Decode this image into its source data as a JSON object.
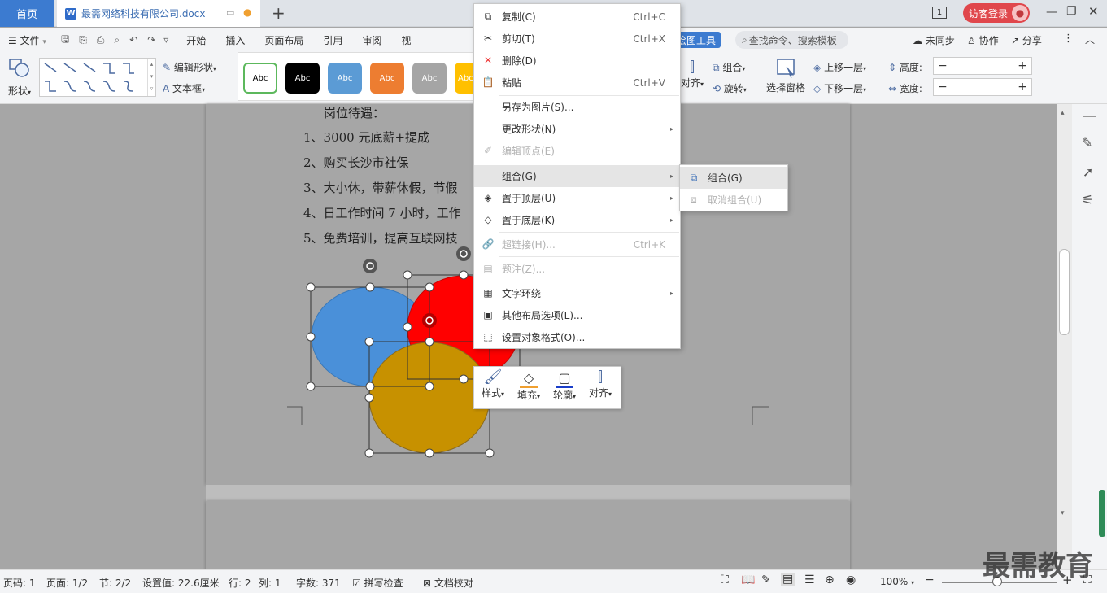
{
  "tabs": {
    "home": "首页",
    "doc_title": "最需网络科技有限公司.docx",
    "doc_badge": "W"
  },
  "window": {
    "user_button": "访客登录",
    "page_badge": "1"
  },
  "menu": {
    "file": "文件",
    "items": [
      "开始",
      "插入",
      "页面布局",
      "引用",
      "审阅",
      "视"
    ],
    "drawing_tools": "绘图工具",
    "search_placeholder": "查找命令、搜索模板",
    "sync": "未同步",
    "collab": "协作",
    "share": "分享"
  },
  "ribbon": {
    "shapes": "形状",
    "edit_shape": "编辑形状",
    "textbox": "文本框",
    "abc": "Abc",
    "group": "组合",
    "rotate": "旋转",
    "align": "对齐",
    "selection_pane": "选择窗格",
    "bring_forward": "上移一层",
    "send_backward": "下移一层",
    "height": "高度:",
    "width": "宽度:"
  },
  "colors": {
    "blue_circle": "#4a90d9",
    "red_circle": "#ff0000",
    "gold_circle": "#c79100",
    "style_white": "#ffffff",
    "style_black": "#000000",
    "style_blue": "#5b9bd5",
    "style_orange": "#ed7d31",
    "style_gray": "#a5a5a5",
    "style_yellow": "#ffc000"
  },
  "document": {
    "lines": [
      "岗位待遇：",
      "1、3000 元底薪+提成",
      "2、购买长沙市社保",
      "3、大小休，带薪休假，节假",
      "4、日工作时间 7 小时，工作",
      "5、免费培训，提高互联网技"
    ]
  },
  "context_menu": {
    "copy": {
      "label": "复制(C)",
      "shortcut": "Ctrl+C"
    },
    "cut": {
      "label": "剪切(T)",
      "shortcut": "Ctrl+X"
    },
    "delete": {
      "label": "删除(D)"
    },
    "paste": {
      "label": "粘贴",
      "shortcut": "Ctrl+V"
    },
    "save_as_image": {
      "label": "另存为图片(S)..."
    },
    "change_shape": {
      "label": "更改形状(N)"
    },
    "edit_points": {
      "label": "编辑顶点(E)"
    },
    "group": {
      "label": "组合(G)"
    },
    "bring_to_front": {
      "label": "置于顶层(U)"
    },
    "send_to_back": {
      "label": "置于底层(K)"
    },
    "hyperlink": {
      "label": "超链接(H)...",
      "shortcut": "Ctrl+K"
    },
    "caption": {
      "label": "题注(Z)..."
    },
    "text_wrap": {
      "label": "文字环绕"
    },
    "layout_options": {
      "label": "其他布局选项(L)..."
    },
    "format_object": {
      "label": "设置对象格式(O)..."
    }
  },
  "submenu": {
    "group": "组合(G)",
    "ungroup": "取消组合(U)"
  },
  "mini_toolbar": {
    "style": "样式",
    "fill": "填充",
    "outline": "轮廓",
    "align": "对齐"
  },
  "status": {
    "page_code": "页码: 1",
    "page": "页面: 1/2",
    "section": "节: 2/2",
    "setting": "设置值: 22.6厘米",
    "row": "行: 2",
    "col": "列: 1",
    "word_count": "字数: 371",
    "spell_check": "拼写检查",
    "doc_proof": "文档校对",
    "zoom": "100%"
  },
  "watermark": "最需教育"
}
